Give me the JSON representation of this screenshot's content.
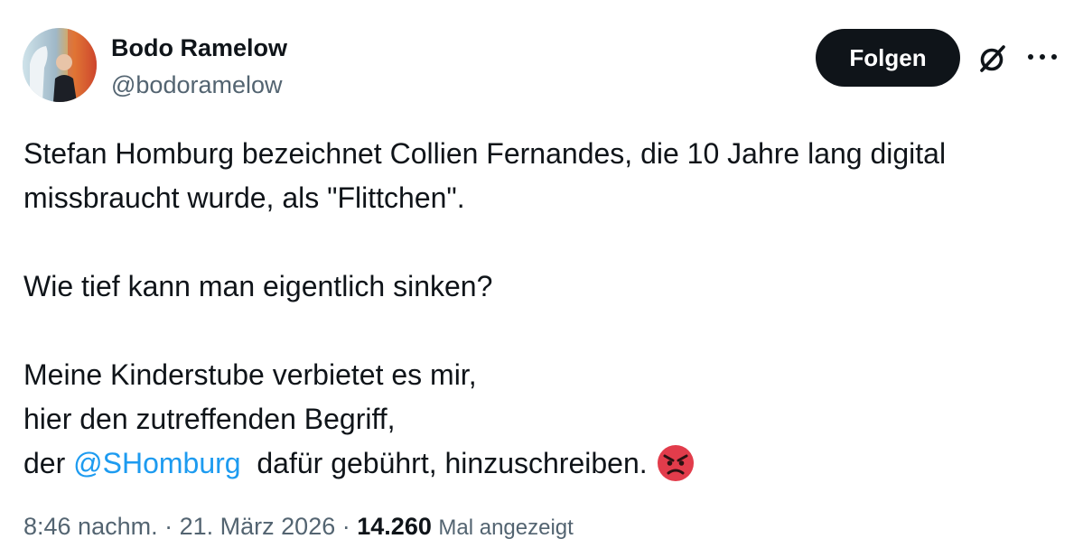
{
  "author": {
    "name": "Bodo Ramelow",
    "handle": "@bodoramelow"
  },
  "actions": {
    "follow_label": "Folgen",
    "grok_icon": "grok-icon",
    "more_icon": "more-icon"
  },
  "tweet": {
    "line1": "Stefan Homburg bezeichnet Collien Fernandes, die 10 Jahre lang digital",
    "line2": "missbraucht wurde, als \"Flittchen\".",
    "line3": "Wie tief kann man eigentlich sinken?",
    "line4": "Meine Kinderstube verbietet es mir,",
    "line5": "hier den zutreffenden Begriff,",
    "line6_prefix": "der",
    "mention": "@SHomburg",
    "line6_suffix": "dafür gebührt, hinzuschreiben.",
    "emoji": "angry-face-emoji"
  },
  "meta": {
    "time": "8:46 nachm.",
    "sep1": "·",
    "date": "21. März 2026",
    "sep2": "·",
    "views_count": "14.260",
    "views_label": "Mal angezeigt"
  },
  "colors": {
    "text": "#0f1419",
    "secondary": "#536471",
    "link": "#1d9bf0",
    "button": "#0f1419"
  }
}
